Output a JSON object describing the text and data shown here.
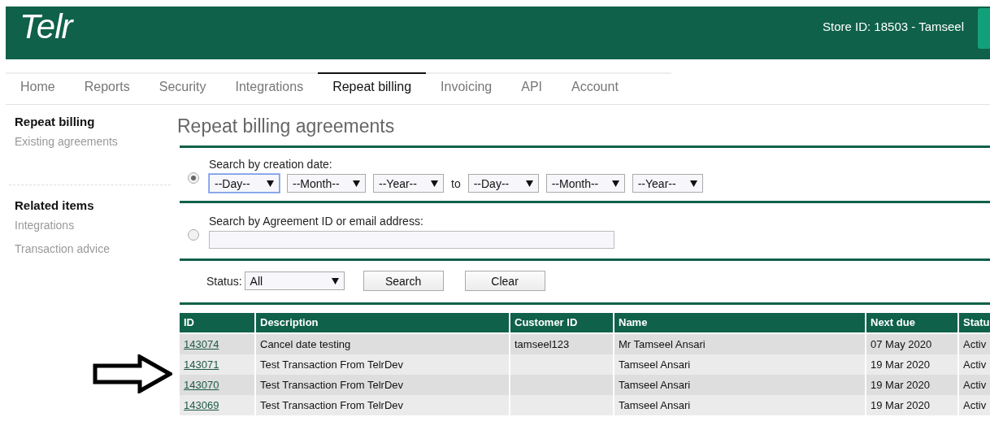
{
  "header": {
    "logo": "Telr",
    "store": "Store ID: 18503 - Tamseel"
  },
  "tabs": [
    {
      "label": "Home",
      "selected": false
    },
    {
      "label": "Reports",
      "selected": false
    },
    {
      "label": "Security",
      "selected": false
    },
    {
      "label": "Integrations",
      "selected": false
    },
    {
      "label": "Repeat billing",
      "selected": true
    },
    {
      "label": "Invoicing",
      "selected": false
    },
    {
      "label": "API",
      "selected": false
    },
    {
      "label": "Account",
      "selected": false
    }
  ],
  "sidebar": [
    {
      "heading": "Repeat billing",
      "items": [
        "Existing agreements"
      ]
    },
    {
      "heading": "Related items",
      "items": [
        "Integrations",
        "Transaction advice"
      ]
    }
  ],
  "page_title": "Repeat billing agreements",
  "search_by_date": {
    "label": "Search by creation date:",
    "selected": true,
    "from": [
      {
        "value": "--Day--",
        "focused": true
      },
      {
        "value": "--Month--",
        "focused": false
      },
      {
        "value": "--Year--",
        "focused": false
      }
    ],
    "to_label": "to",
    "to": [
      {
        "value": "--Day--",
        "focused": false
      },
      {
        "value": "--Month--",
        "focused": false
      },
      {
        "value": "--Year--",
        "focused": false
      }
    ]
  },
  "search_by_id": {
    "label": "Search by Agreement ID or email address:",
    "selected": false
  },
  "status": {
    "label": "Status:",
    "value": "All"
  },
  "buttons": [
    "Search",
    "Clear"
  ],
  "table": {
    "columns": [
      "ID",
      "Description",
      "Customer ID",
      "Name",
      "Next due",
      "Statu"
    ],
    "rows": [
      [
        "143074",
        "Cancel date testing",
        "tamseel123",
        "Mr Tamseel Ansari",
        "07 May 2020",
        "Activ"
      ],
      [
        "143071",
        "Test Transaction From TelrDev",
        "",
        "Tamseel Ansari",
        "19 Mar 2020",
        "Activ"
      ],
      [
        "143070",
        "Test Transaction From TelrDev",
        "",
        "Tamseel Ansari",
        "19 Mar 2020",
        "Activ"
      ],
      [
        "143069",
        "Test Transaction From TelrDev",
        "",
        "Tamseel Ansari",
        "19 Mar 2020",
        "Activ"
      ]
    ]
  }
}
